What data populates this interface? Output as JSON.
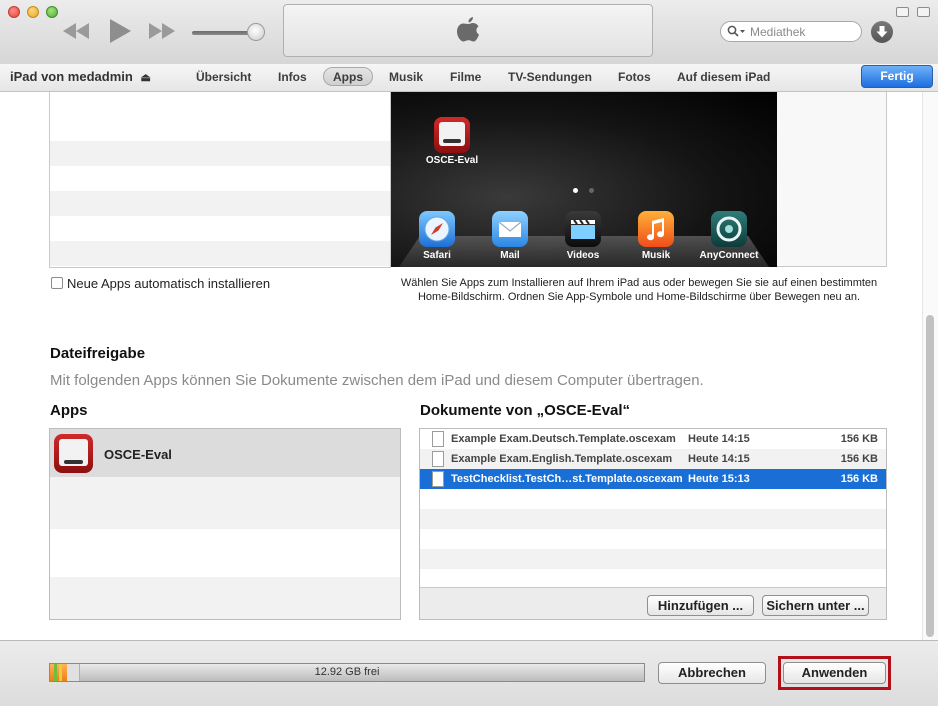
{
  "window": {
    "lcd_logo": "apple-logo-icon"
  },
  "search": {
    "placeholder": "Mediathek"
  },
  "navbar": {
    "device_name": "iPad von medadmin",
    "tabs": [
      {
        "label": "Übersicht"
      },
      {
        "label": "Infos"
      },
      {
        "label": "Apps",
        "selected": true
      },
      {
        "label": "Musik"
      },
      {
        "label": "Filme"
      },
      {
        "label": "TV-Sendungen"
      },
      {
        "label": "Fotos"
      },
      {
        "label": "Auf diesem iPad"
      }
    ],
    "done_label": "Fertig"
  },
  "homescreen": {
    "installed_app": "OSCE-Eval",
    "dock_apps": [
      "Safari",
      "Mail",
      "Videos",
      "Musik",
      "AnyConnect"
    ],
    "help_line1": "Wählen Sie Apps zum Installieren auf Ihrem iPad aus oder bewegen Sie sie auf einen bestimmten",
    "help_line2": "Home-Bildschirm. Ordnen Sie App-Symbole und Home-Bildschirme über Bewegen neu an."
  },
  "auto_install": {
    "label": "Neue Apps automatisch installieren",
    "checked": false
  },
  "file_sharing": {
    "title": "Dateifreigabe",
    "description": "Mit folgenden Apps können Sie Dokumente zwischen dem iPad und diesem Computer übertragen.",
    "apps_title": "Apps",
    "apps": [
      {
        "name": "OSCE-Eval"
      }
    ],
    "docs_title": "Dokumente von „OSCE-Eval“",
    "documents": [
      {
        "name": "Example Exam.Deutsch.Template.oscexam",
        "date": "Heute 14:15",
        "size": "156 KB"
      },
      {
        "name": "Example Exam.English.Template.oscexam",
        "date": "Heute 14:15",
        "size": "156 KB"
      },
      {
        "name": "TestChecklist.TestCh…st.Template.oscexam",
        "date": "Heute 15:13",
        "size": "156 KB",
        "selected": true
      }
    ],
    "add_label": "Hinzufügen ...",
    "save_label": "Sichern unter ..."
  },
  "footer": {
    "capacity_text": "12.92 GB frei",
    "cancel_label": "Abbrechen",
    "apply_label": "Anwenden"
  },
  "colors": {
    "accent": "#1a6fd6",
    "highlight_border": "#b3111a"
  }
}
